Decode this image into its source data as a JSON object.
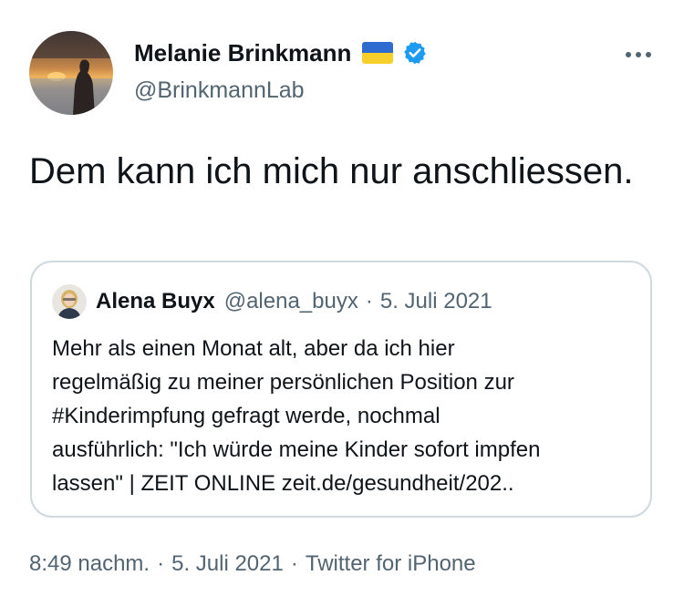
{
  "author": {
    "name": "Melanie Brinkmann",
    "handle": "@BrinkmannLab",
    "flag_colors": {
      "top": "#2d6bd1",
      "bottom": "#f7cf2b"
    },
    "verified_color": "#1d9bf0",
    "avatar_icon": "sunset-person-photo"
  },
  "tweet": {
    "text": "Dem kann ich mich nur anschliessen."
  },
  "quoted": {
    "name": "Alena Buyx",
    "handle": "@alena_buyx",
    "separator": "·",
    "date": "5. Juli 2021",
    "text_lines": [
      "Mehr als einen Monat alt, aber da ich hier",
      "regelmäßig zu meiner persönlichen Position zur",
      "#Kinderimpfung gefragt werde, nochmal",
      "ausführlich: \"Ich würde meine Kinder sofort impfen",
      "lassen\" | ZEIT ONLINE zeit.de/gesundheit/202.."
    ]
  },
  "meta": {
    "time": "8:49 nachm.",
    "separator": "·",
    "date": "5. Juli 2021",
    "source": "Twitter for iPhone"
  },
  "icons": {
    "more": "more-options-icon",
    "verified": "verified-badge-icon",
    "flag": "ukraine-flag-icon"
  },
  "colors": {
    "text_primary": "#0f1419",
    "text_secondary": "#536471",
    "border": "#cfd9de"
  }
}
